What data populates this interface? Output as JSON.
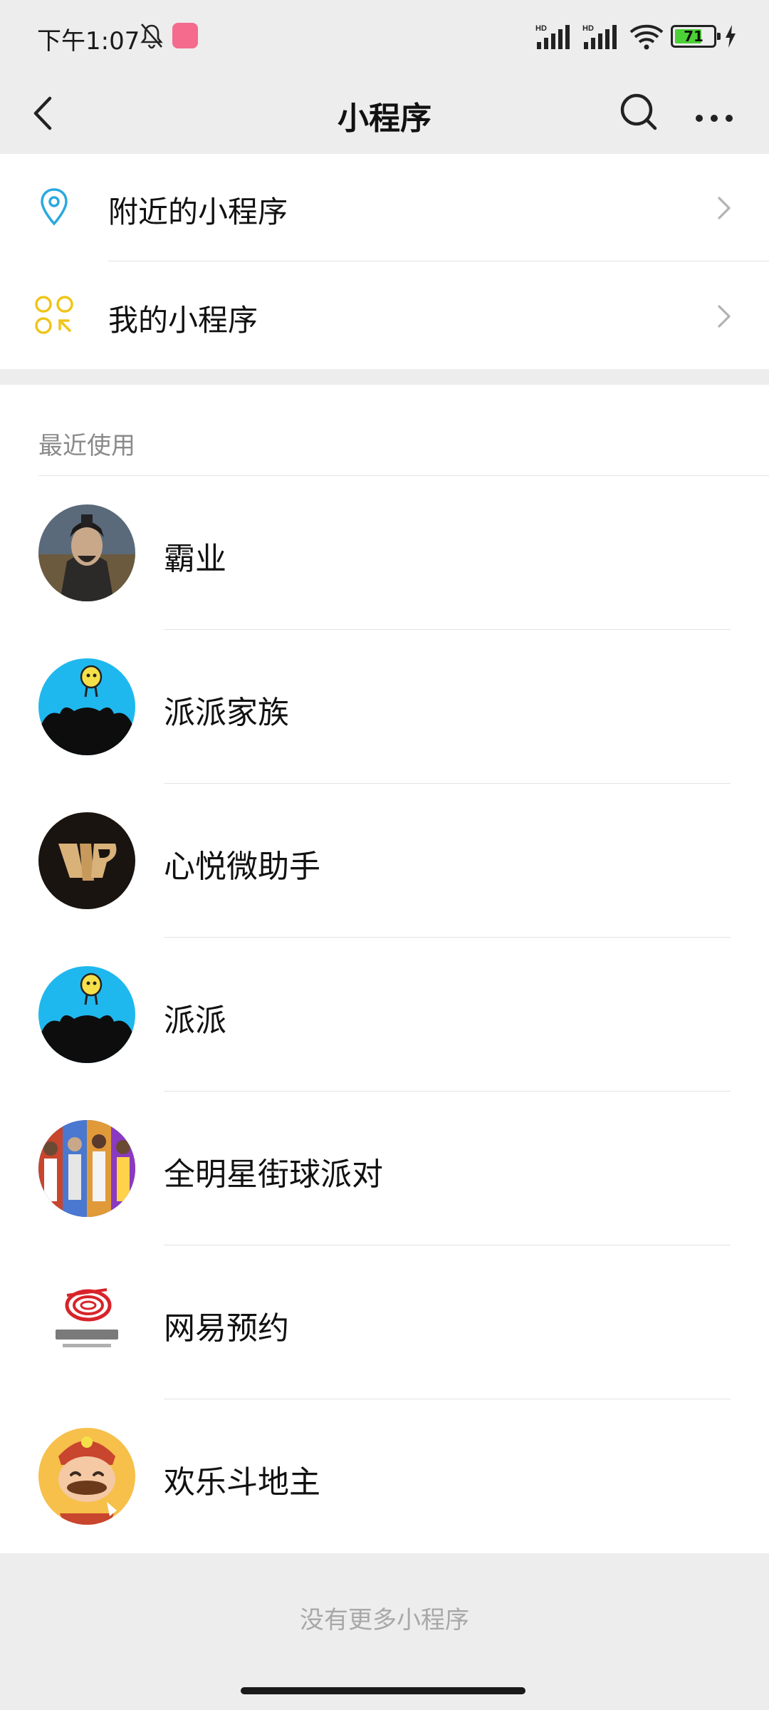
{
  "status_bar": {
    "time": "下午1:07",
    "battery_level": "71",
    "battery_percent": 71,
    "network_1": "HD",
    "network_2": "HD"
  },
  "nav": {
    "title": "小程序",
    "icons": [
      "back-arrow-icon",
      "search-icon",
      "more-icon"
    ]
  },
  "entries": [
    {
      "label": "附近的小程序",
      "icon": "location-pin-icon",
      "color": "#2aa8e0"
    },
    {
      "label": "我的小程序",
      "icon": "grid-circles-icon",
      "color": "#f0c419"
    }
  ],
  "recent": {
    "header": "最近使用",
    "items": [
      {
        "name": "霸业"
      },
      {
        "name": "派派家族"
      },
      {
        "name": "心悦微助手"
      },
      {
        "name": "派派"
      },
      {
        "name": "全明星街球派对"
      },
      {
        "name": "网易预约"
      },
      {
        "name": "欢乐斗地主"
      }
    ]
  },
  "footer": {
    "text": "没有更多小程序"
  },
  "colors": {
    "background": "#ededed",
    "card": "#ffffff",
    "secondary_text": "#8a8a8a",
    "footer_text": "#a8a8a8",
    "paipai_blue": "#1fb8ee"
  }
}
